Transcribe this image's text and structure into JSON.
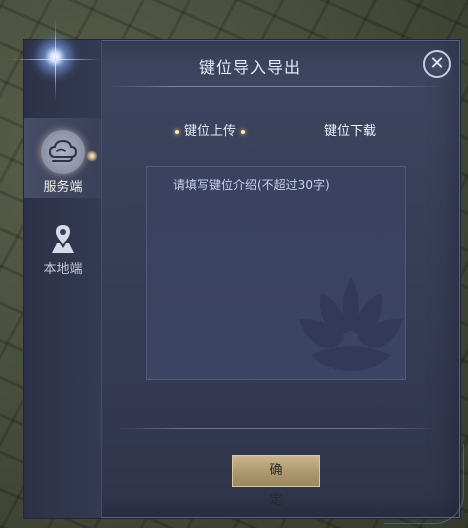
{
  "dialog": {
    "title": "键位导入导出",
    "close_icon": "close-icon"
  },
  "sidebar": {
    "items": [
      {
        "label": "服务端",
        "icon": "cloud-icon",
        "active": true
      },
      {
        "label": "本地端",
        "icon": "map-pin-icon",
        "active": false
      }
    ]
  },
  "tabs": [
    {
      "label": "键位上传",
      "active": true
    },
    {
      "label": "键位下载",
      "active": false
    }
  ],
  "input": {
    "placeholder": "请填写键位介绍(不超过30字)",
    "value": ""
  },
  "footer": {
    "confirm_label": "确 定"
  },
  "colors": {
    "panel": "#363c55",
    "accent_gold": "#b09a70",
    "text": "#e6e9f3"
  }
}
